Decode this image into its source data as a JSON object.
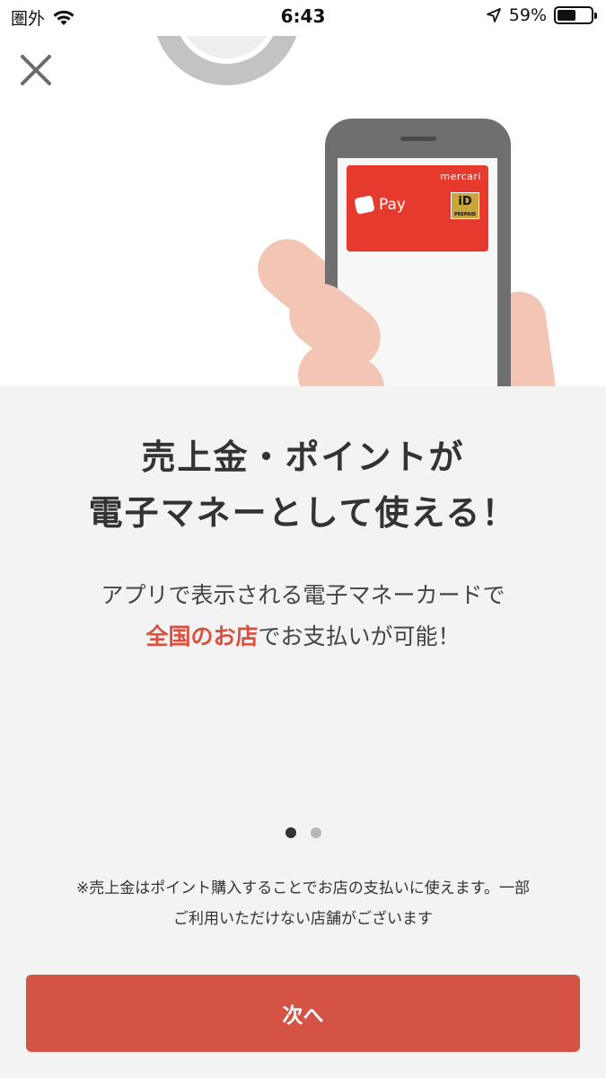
{
  "status_bar": {
    "carrier": "圏外",
    "time": "6:43",
    "battery_percent": "59%",
    "battery_level": 0.59
  },
  "illustration": {
    "card_brand": "mercari",
    "card_pay": "Pay",
    "card_id": "iD",
    "card_id_sub": "PREPAID"
  },
  "headline": {
    "line1": "売上金・ポイントが",
    "line2": "電子マネーとして使える！"
  },
  "description": {
    "line1": "アプリで表示される電子マネーカードで",
    "highlight": "全国のお店",
    "line2_rest": "でお支払いが可能！"
  },
  "pagination": {
    "total": 2,
    "current": 1
  },
  "note": {
    "line1": "※売上金はポイント購入することでお店の支払いに使えます。一部",
    "line2": "ご利用いただけない店舗がございます"
  },
  "next_button": {
    "label": "次へ"
  },
  "colors": {
    "accent": "#d45345",
    "card_red": "#e63a2e",
    "highlight": "#d85240"
  }
}
